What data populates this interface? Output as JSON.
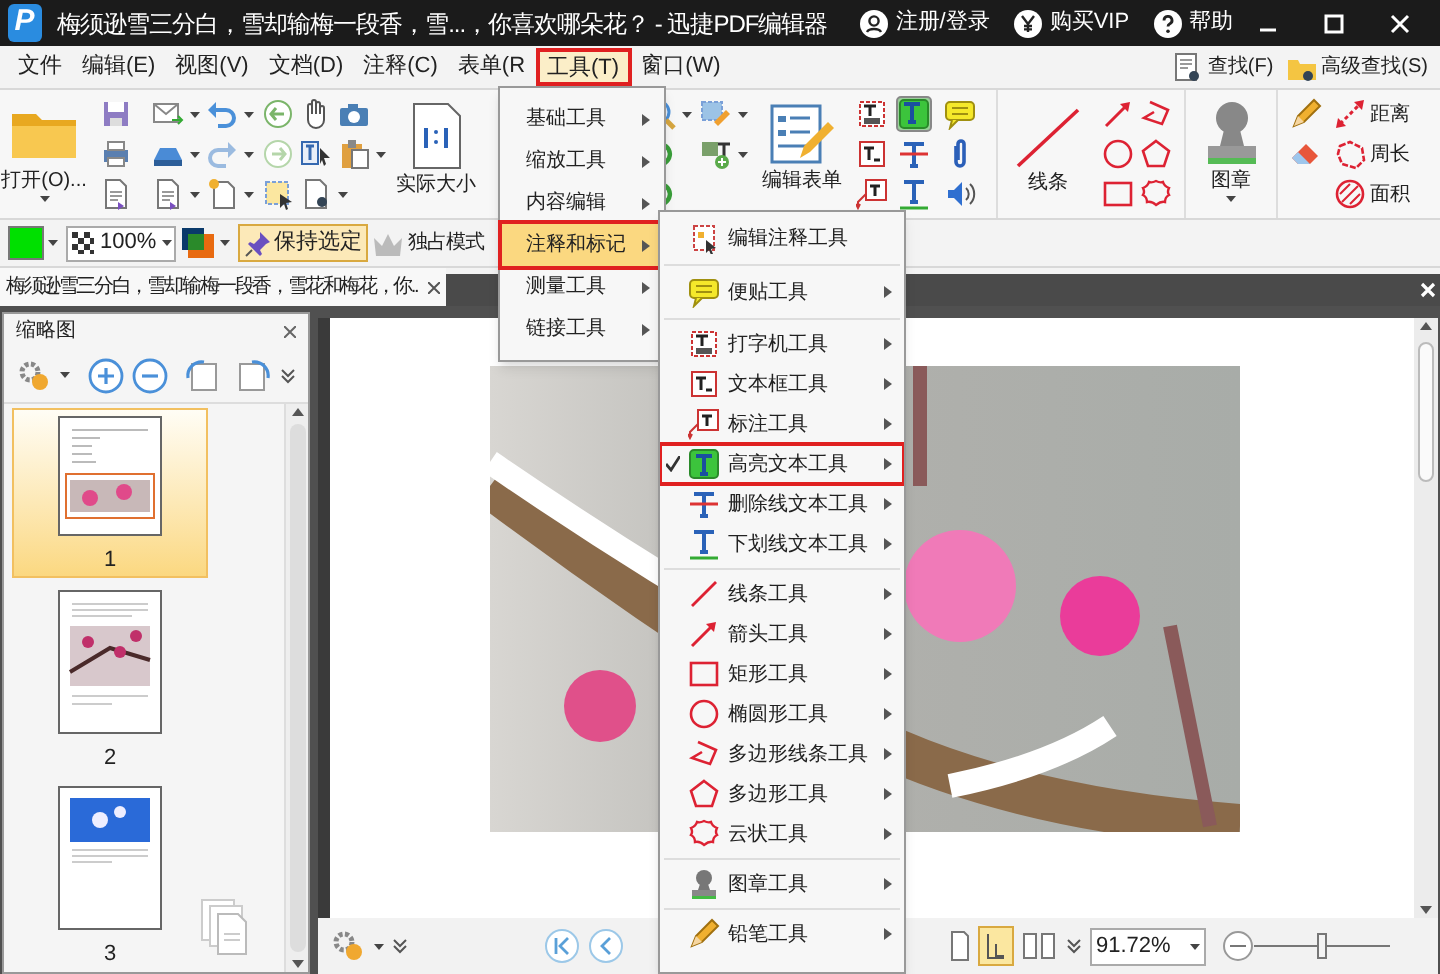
{
  "title_bar": {
    "logo": "P",
    "title": "梅须逊雪三分白，雪却输梅一段香，雪...，你喜欢哪朵花？ - 迅捷PDF编辑器",
    "links": [
      "注册/登录",
      "购买VIP",
      "帮助"
    ]
  },
  "menu_bar": {
    "items": [
      {
        "label": "文件",
        "selected": false
      },
      {
        "label": "编辑(E)",
        "selected": false
      },
      {
        "label": "视图(V)",
        "selected": false
      },
      {
        "label": "文档(D)",
        "selected": false
      },
      {
        "label": "注释(C)",
        "selected": false
      },
      {
        "label": "表单(R",
        "selected": false
      },
      {
        "label": "工具(T)",
        "selected": true
      },
      {
        "label": "窗口(W)",
        "selected": false
      }
    ],
    "search": [
      "查找(F)",
      "高级查找(S)"
    ]
  },
  "ribbon": {
    "open": "打开(O)...",
    "actual_size": "实际大小",
    "edit_form": "编辑表单",
    "lines": "线条",
    "stamp": "图章",
    "distance": "距离",
    "perimeter": "周长",
    "area": "面积"
  },
  "format_bar": {
    "zoom": "100%",
    "keep_selected": {
      "label": "保持选定",
      "on": true
    },
    "exclusive_mode": "独占模式"
  },
  "tabs": [
    {
      "label": "梅须逊雪三分白，雪却输梅一段香，雪花和梅花，你..",
      "selected": true
    }
  ],
  "thumbnails": {
    "title": "缩略图",
    "pages": [
      {
        "label": "1",
        "selected": true
      },
      {
        "label": "2",
        "selected": false
      },
      {
        "label": "3",
        "selected": false
      }
    ]
  },
  "status_bar": {
    "zoom": "91.72%"
  },
  "tools_menu": {
    "items": [
      {
        "label": "基础工具",
        "selected": false
      },
      {
        "label": "缩放工具",
        "selected": false
      },
      {
        "label": "内容编辑",
        "selected": false
      },
      {
        "label": "注释和标记",
        "selected": true
      },
      {
        "label": "测量工具",
        "selected": false
      },
      {
        "label": "链接工具",
        "selected": false
      }
    ]
  },
  "annotation_menu": {
    "groups": [
      [
        {
          "label": "编辑注释工具",
          "checked": false,
          "selected": false,
          "submenu": false
        }
      ],
      [
        {
          "label": "便贴工具",
          "checked": false,
          "selected": false,
          "submenu": true
        }
      ],
      [
        {
          "label": "打字机工具",
          "checked": false,
          "selected": false,
          "submenu": true
        },
        {
          "label": "文本框工具",
          "checked": false,
          "selected": false,
          "submenu": true
        },
        {
          "label": "标注工具",
          "checked": false,
          "selected": false,
          "submenu": true
        },
        {
          "label": "高亮文本工具",
          "checked": true,
          "selected": true,
          "submenu": true
        },
        {
          "label": "删除线文本工具",
          "checked": false,
          "selected": false,
          "submenu": true
        },
        {
          "label": "下划线文本工具",
          "checked": false,
          "selected": false,
          "submenu": true
        }
      ],
      [
        {
          "label": "线条工具",
          "checked": false,
          "selected": false,
          "submenu": true
        },
        {
          "label": "箭头工具",
          "checked": false,
          "selected": false,
          "submenu": true
        },
        {
          "label": "矩形工具",
          "checked": false,
          "selected": false,
          "submenu": true
        },
        {
          "label": "椭圆形工具",
          "checked": false,
          "selected": false,
          "submenu": true
        },
        {
          "label": "多边形线条工具",
          "checked": false,
          "selected": false,
          "submenu": true
        },
        {
          "label": "多边形工具",
          "checked": false,
          "selected": false,
          "submenu": true
        },
        {
          "label": "云状工具",
          "checked": false,
          "selected": false,
          "submenu": true
        }
      ],
      [
        {
          "label": "图章工具",
          "checked": false,
          "selected": false,
          "submenu": true
        }
      ],
      [
        {
          "label": "铅笔工具",
          "checked": false,
          "selected": false,
          "submenu": true
        }
      ]
    ]
  }
}
